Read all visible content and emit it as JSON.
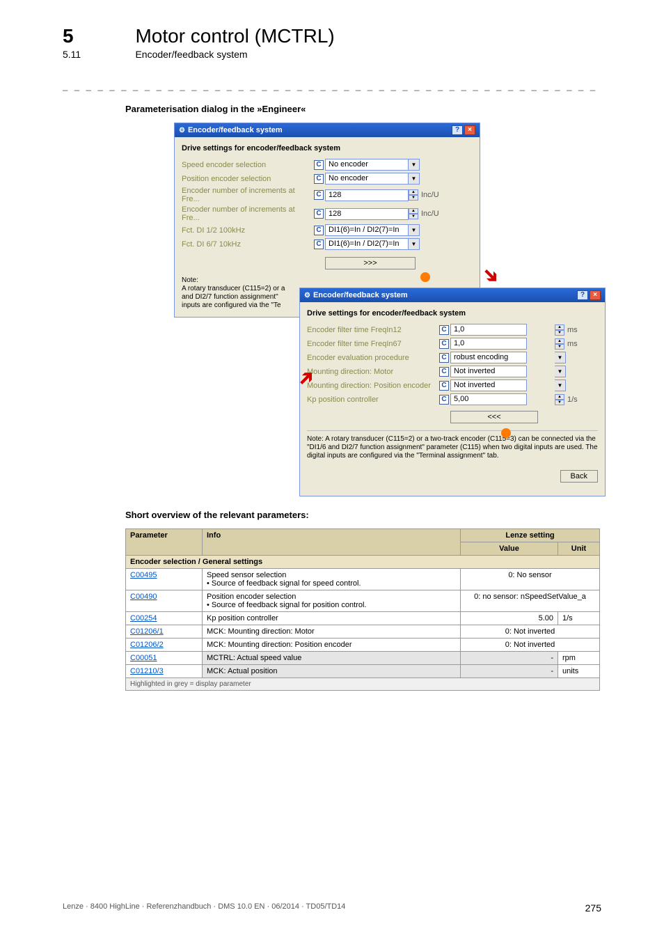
{
  "header": {
    "sectionNum": "5",
    "sectionTitle": "Motor control (MCTRL)",
    "subNum": "5.11",
    "subTitle": "Encoder/feedback system"
  },
  "headings": {
    "paramDialog": "Parameterisation dialog in the »Engineer«",
    "shortOverview": "Short overview of the relevant parameters:"
  },
  "dialog1": {
    "title": "Encoder/feedback system",
    "driveHead": "Drive settings for encoder/feedback system",
    "rows": [
      {
        "label": "Speed encoder selection",
        "value": "No encoder",
        "type": "dd"
      },
      {
        "label": "Position encoder selection",
        "value": "No encoder",
        "type": "dd"
      },
      {
        "label": "Encoder number of increments at Fre...",
        "value": "128",
        "type": "spin",
        "unit": "Inc/U"
      },
      {
        "label": "Encoder number of increments at Fre...",
        "value": "128",
        "type": "spin",
        "unit": "Inc/U"
      },
      {
        "label": "Fct. DI 1/2 100kHz",
        "value": "DI1(6)=In / DI2(7)=In",
        "type": "dd"
      },
      {
        "label": "Fct. DI 6/7 10kHz",
        "value": "DI1(6)=In / DI2(7)=In",
        "type": "dd"
      }
    ],
    "moreBtn": ">>>",
    "note": "Note:\nA rotary transducer (C115=2) or a\nand DI2/7 function assignment\"\ninputs are configured via the \"Te"
  },
  "dialog2": {
    "title": "Encoder/feedback system",
    "driveHead": "Drive settings for encoder/feedback system",
    "rows": [
      {
        "label": "Encoder filter time FreqIn12",
        "value": "1,0",
        "type": "spin",
        "unit": "ms"
      },
      {
        "label": "Encoder filter time FreqIn67",
        "value": "1,0",
        "type": "spin",
        "unit": "ms"
      },
      {
        "label": "Encoder evaluation procedure",
        "value": "robust encoding",
        "type": "dd"
      },
      {
        "label": "Mounting direction: Motor",
        "value": "Not inverted",
        "type": "dd"
      },
      {
        "label": "Mounting direction: Position encoder",
        "value": "Not inverted",
        "type": "dd"
      },
      {
        "label": "Kp position controller",
        "value": "5,00",
        "type": "spin",
        "unit": "1/s"
      }
    ],
    "lessBtn": "<<<",
    "note": "Note:\nA rotary transducer (C115=2) or a two-track encoder (C115=3) can be connected via the \"DI1/6 and DI2/7 function assignment\" parameter (C115) when two digital inputs are used. The digital inputs are configured via the \"Terminal assignment\" tab.",
    "backBtn": "Back"
  },
  "table": {
    "headers": {
      "param": "Parameter",
      "info": "Info",
      "lenze": "Lenze setting",
      "value": "Value",
      "unit": "Unit"
    },
    "section": "Encoder selection / General settings",
    "rows": [
      {
        "code": "C00495",
        "info": "Speed sensor selection",
        "sub": "• Source of feedback signal for speed control.",
        "value": "0: No sensor",
        "unit": ""
      },
      {
        "code": "C00490",
        "info": "Position encoder selection",
        "sub": "• Source of feedback signal for position control.",
        "value": "0: no sensor: nSpeedSetValue_a",
        "unit": ""
      },
      {
        "code": "C00254",
        "info": "Kp position controller",
        "sub": "",
        "value": "5.00",
        "unit": "1/s"
      },
      {
        "code": "C01206/1",
        "info": "MCK: Mounting direction: Motor",
        "sub": "",
        "value": "0: Not inverted",
        "unit": ""
      },
      {
        "code": "C01206/2",
        "info": "MCK: Mounting direction: Position encoder",
        "sub": "",
        "value": "0: Not inverted",
        "unit": ""
      },
      {
        "code": "C00051",
        "info": "MCTRL: Actual speed value",
        "sub": "",
        "value": "-",
        "unit": "rpm",
        "grey": true
      },
      {
        "code": "C01210/3",
        "info": "MCK: Actual position",
        "sub": "",
        "value": "-",
        "unit": "units",
        "grey": true
      }
    ],
    "footnote": "Highlighted in grey = display parameter"
  },
  "footer": {
    "left": "Lenze · 8400 HighLine · Referenzhandbuch · DMS 10.0 EN · 06/2014 · TD05/TD14",
    "right": "275"
  }
}
